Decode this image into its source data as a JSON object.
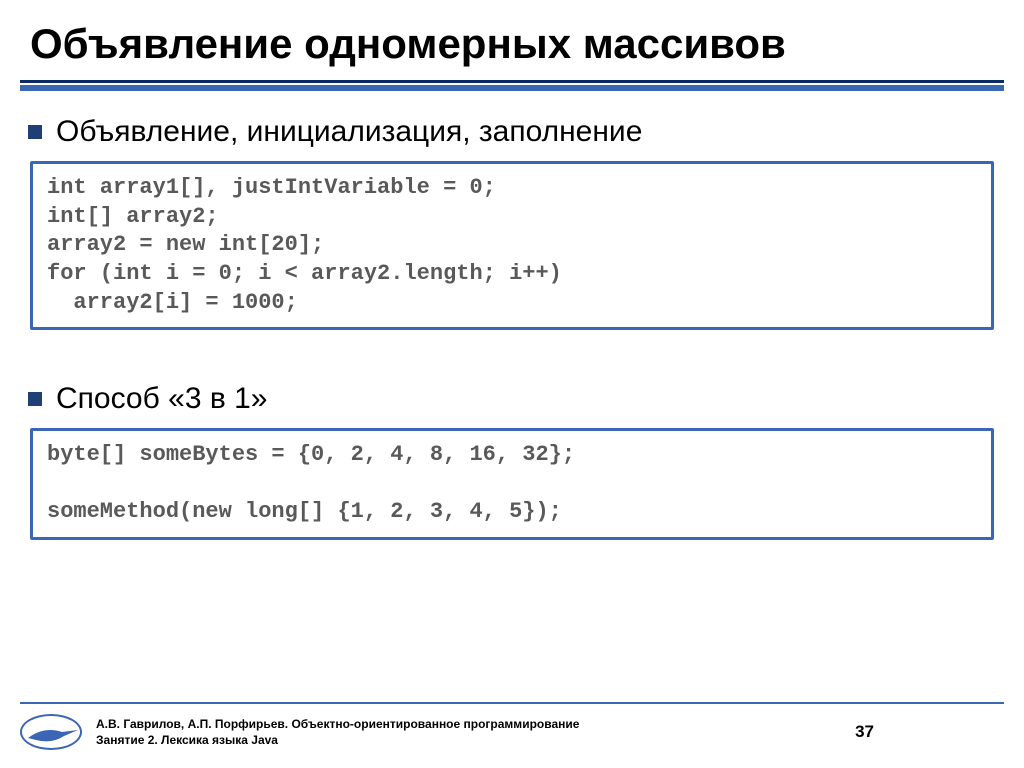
{
  "title": "Объявление одномерных массивов",
  "bullets": {
    "b1": "Объявление, инициализация, заполнение",
    "b2": "Способ «3 в 1»"
  },
  "code": {
    "block1": "int array1[], justIntVariable = 0;\nint[] array2;\narray2 = new int[20];\nfor (int i = 0; i < array2.length; i++)\n  array2[i] = 1000;",
    "block2": "byte[] someBytes = {0, 2, 4, 8, 16, 32};\n\nsomeMethod(new long[] {1, 2, 3, 4, 5});"
  },
  "footer": {
    "line1": "А.В. Гаврилов, А.П. Порфирьев. Объектно-ориентированное программирование",
    "line2": "Занятие 2. Лексика языка Java",
    "page": "37"
  }
}
